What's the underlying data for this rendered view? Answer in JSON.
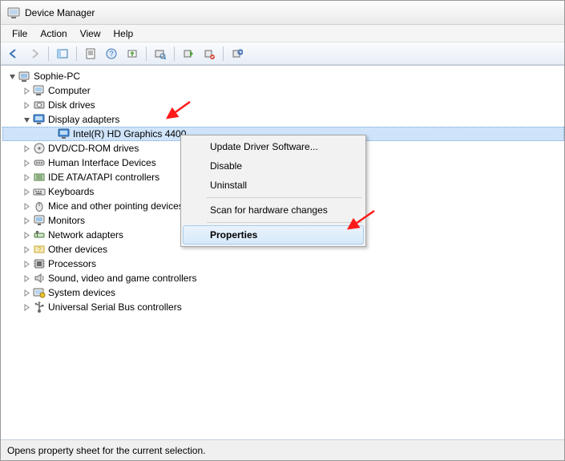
{
  "window": {
    "title": "Device Manager"
  },
  "menubar": {
    "items": [
      "File",
      "Action",
      "View",
      "Help"
    ]
  },
  "tree": {
    "root": "Sophie-PC",
    "nodes": [
      {
        "label": "Computer",
        "expanded": false,
        "icon": "computer-icon"
      },
      {
        "label": "Disk drives",
        "expanded": false,
        "icon": "disk-icon"
      },
      {
        "label": "Display adapters",
        "expanded": true,
        "icon": "display-icon",
        "children": [
          {
            "label": "Intel(R) HD Graphics 4400",
            "icon": "display-icon",
            "selected": true
          }
        ]
      },
      {
        "label": "DVD/CD-ROM drives",
        "expanded": false,
        "icon": "optical-icon"
      },
      {
        "label": "Human Interface Devices",
        "expanded": false,
        "icon": "hid-icon"
      },
      {
        "label": "IDE ATA/ATAPI controllers",
        "expanded": false,
        "icon": "ide-icon"
      },
      {
        "label": "Keyboards",
        "expanded": false,
        "icon": "keyboard-icon"
      },
      {
        "label": "Mice and other pointing devices",
        "expanded": false,
        "icon": "mouse-icon"
      },
      {
        "label": "Monitors",
        "expanded": false,
        "icon": "monitor-icon"
      },
      {
        "label": "Network adapters",
        "expanded": false,
        "icon": "network-icon"
      },
      {
        "label": "Other devices",
        "expanded": false,
        "icon": "other-icon"
      },
      {
        "label": "Processors",
        "expanded": false,
        "icon": "cpu-icon"
      },
      {
        "label": "Sound, video and game controllers",
        "expanded": false,
        "icon": "sound-icon"
      },
      {
        "label": "System devices",
        "expanded": false,
        "icon": "system-icon"
      },
      {
        "label": "Universal Serial Bus controllers",
        "expanded": false,
        "icon": "usb-icon"
      }
    ]
  },
  "context_menu": {
    "items": [
      {
        "label": "Update Driver Software...",
        "sep_after": false
      },
      {
        "label": "Disable",
        "sep_after": false
      },
      {
        "label": "Uninstall",
        "sep_after": true
      },
      {
        "label": "Scan for hardware changes",
        "sep_after": true
      },
      {
        "label": "Properties",
        "sep_after": false,
        "highlighted": true
      }
    ]
  },
  "statusbar": {
    "text": "Opens property sheet for the current selection."
  }
}
